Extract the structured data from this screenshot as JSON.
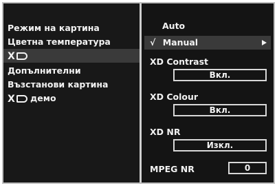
{
  "left_menu": {
    "items": [
      {
        "label": "Режим на картина"
      },
      {
        "label": "Цветна температура"
      },
      {
        "label": "XD",
        "logo": true
      },
      {
        "label": "Допълнителни"
      },
      {
        "label": "Възстанови картина"
      },
      {
        "label": "демо",
        "logo_prefix": "XD"
      }
    ]
  },
  "right_panel": {
    "auto": "Auto",
    "manual_check": "√",
    "manual": "Manual",
    "xd_contrast": {
      "label": "XD Contrast",
      "value": "Вкл."
    },
    "xd_colour": {
      "label": "XD Colour",
      "value": "Вкл."
    },
    "xd_nr": {
      "label": "XD NR",
      "value": "Изкл."
    },
    "mpeg_nr": {
      "label": "MPEG NR",
      "value": "0"
    }
  },
  "colors": {
    "background": "#161616",
    "highlight": "#3a3a3a",
    "text": "#f2f2f2",
    "frame": "#bdbdbd"
  }
}
